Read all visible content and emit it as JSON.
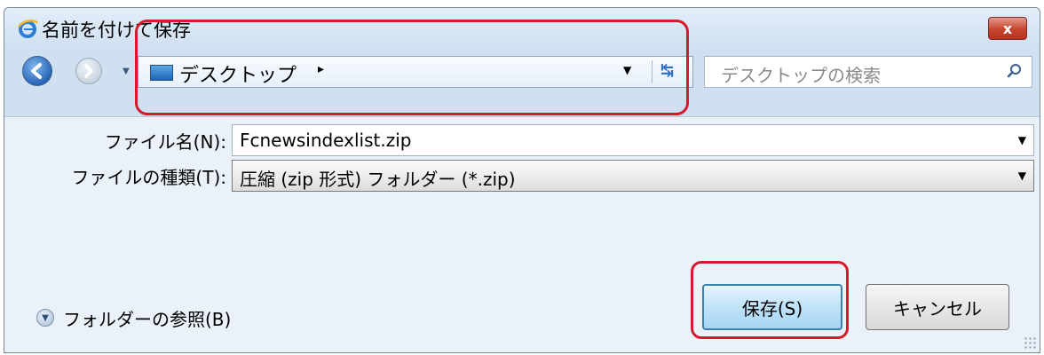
{
  "window": {
    "title": "名前を付けて保存",
    "close_label": "x"
  },
  "address": {
    "location": "デスクトップ",
    "separator_arrow": "▸"
  },
  "search": {
    "placeholder": "デスクトップの検索"
  },
  "form": {
    "filename_label": "ファイル名(N):",
    "filename_value": "Fcnewsindexlist.zip",
    "filetype_label": "ファイルの種類(T):",
    "filetype_value": "圧縮 (zip 形式) フォルダー (*.zip)"
  },
  "browse": {
    "label": "フォルダーの参照(B)"
  },
  "buttons": {
    "save": "保存(S)",
    "cancel": "キャンセル"
  },
  "colors": {
    "highlight": "#d41a2c",
    "accent": "#3c7fb1"
  }
}
